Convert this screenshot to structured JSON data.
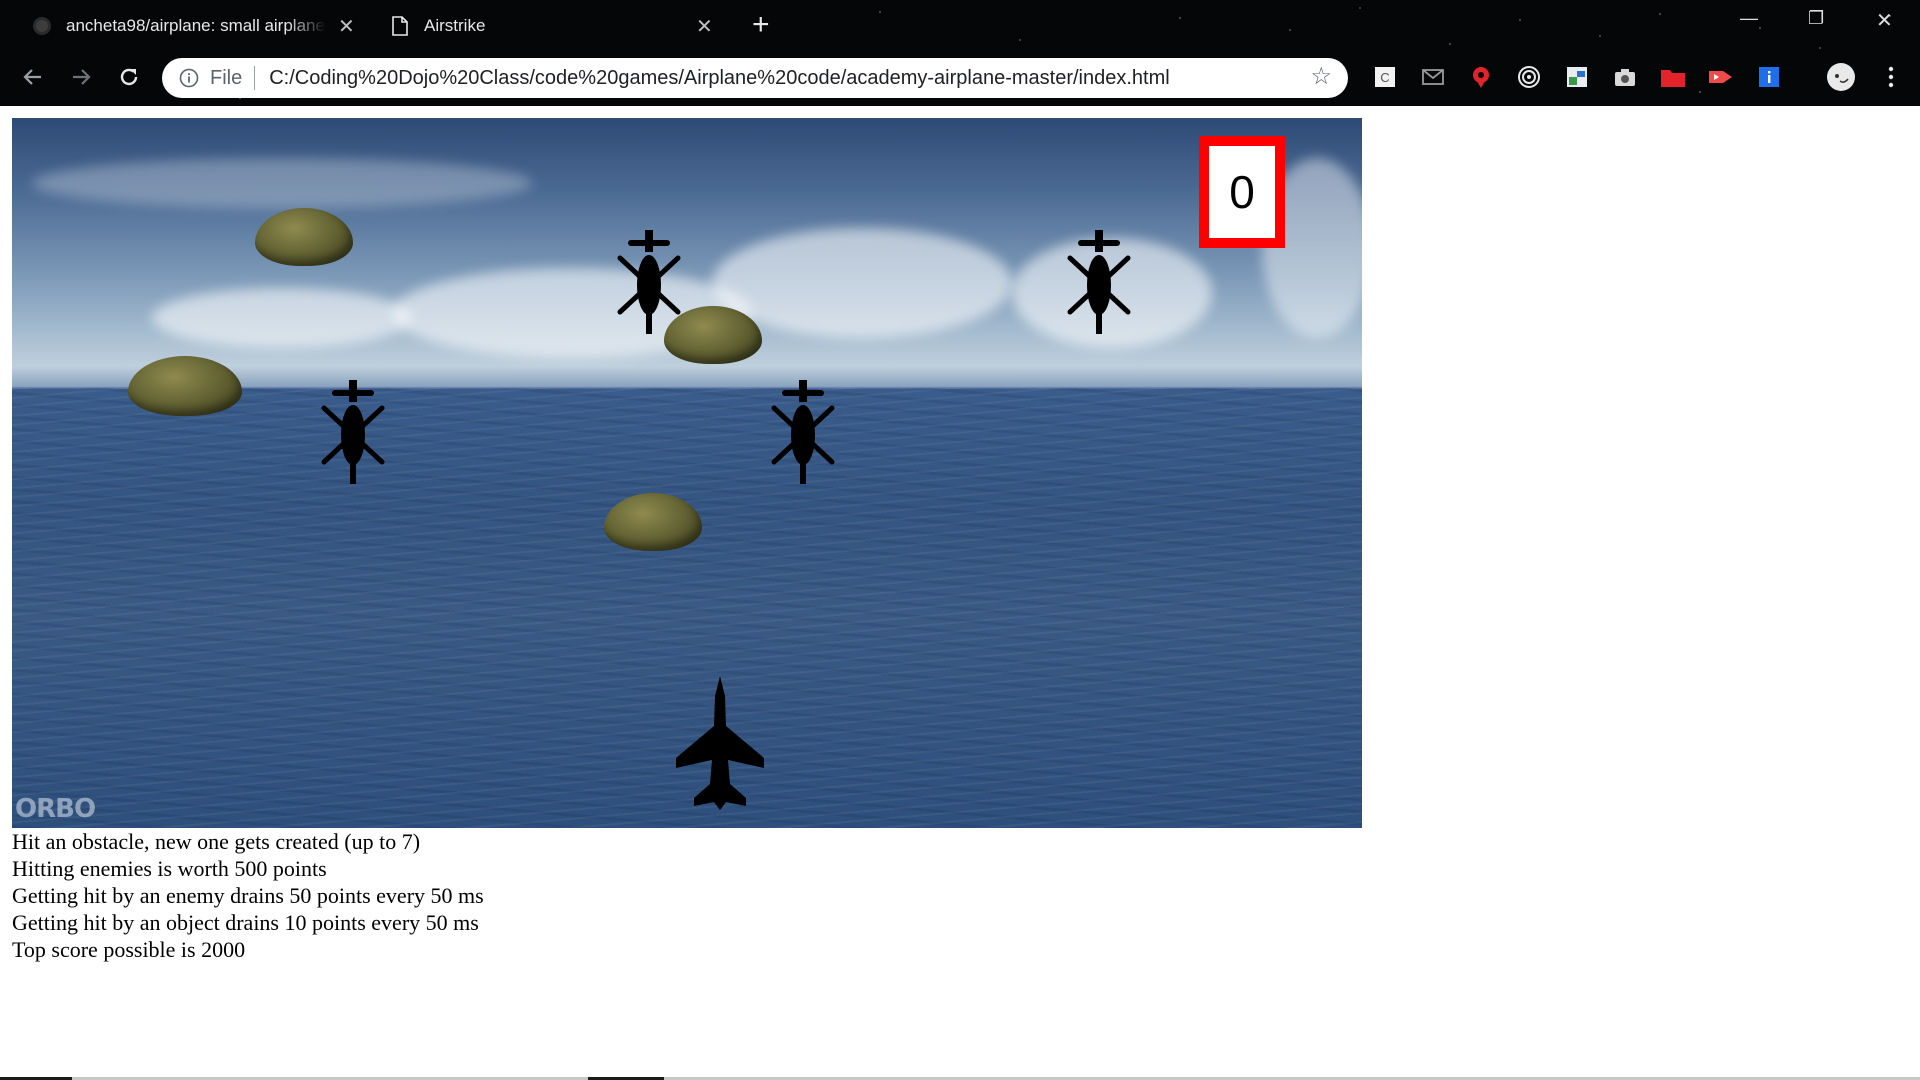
{
  "browser": {
    "tabs": [
      {
        "title": "ancheta98/airplane: small airplane",
        "favicon": "github-icon",
        "active": false
      },
      {
        "title": "Airstrike",
        "favicon": "page-icon",
        "active": true
      }
    ],
    "address": {
      "scheme_label": "File",
      "url": "C:/Coding%20Dojo%20Class/code%20games/Airplane%20code/academy-airplane-master/index.html"
    }
  },
  "game": {
    "score": "0",
    "watermark": "ORBO",
    "colors": {
      "score_border": "#ff0000",
      "sea": "#345581",
      "sky": "#a4bbcf"
    }
  },
  "info": {
    "lines": [
      "Hit an obstacle, new one gets created (up to 7)",
      "Hitting enemies is worth 500 points",
      "Getting hit by an enemy drains 50 points every 50 ms",
      "Getting hit by an object drains 10 points every 50 ms",
      "Top score possible is 2000"
    ]
  }
}
